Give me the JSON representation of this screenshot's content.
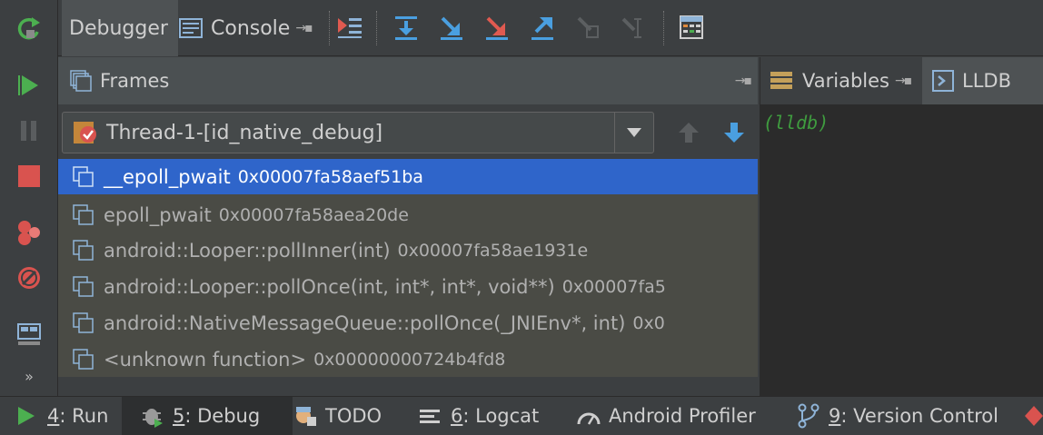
{
  "tabs": {
    "debugger": "Debugger",
    "console": "Console"
  },
  "frames_panel": {
    "title": "Frames",
    "thread": "Thread-1-[id_native_debug]",
    "frames": [
      {
        "fn": "__epoll_pwait",
        "addr": "0x00007fa58aef51ba",
        "selected": true
      },
      {
        "fn": "epoll_pwait",
        "addr": "0x00007fa58aea20de",
        "selected": false
      },
      {
        "fn": "android::Looper::pollInner(int)",
        "addr": "0x00007fa58ae1931e",
        "selected": false
      },
      {
        "fn": "android::Looper::pollOnce(int, int*, int*, void**)",
        "addr": "0x00007fa5",
        "selected": false
      },
      {
        "fn": "android::NativeMessageQueue::pollOnce(_JNIEnv*, int)",
        "addr": "0x0",
        "selected": false
      },
      {
        "fn": "<unknown function>",
        "addr": "0x00000000724b4fd8",
        "selected": false
      }
    ]
  },
  "right_panel": {
    "variables_tab": "Variables",
    "lldb_tab": "LLDB",
    "prompt": "(lldb)"
  },
  "bottom_bar": {
    "run": {
      "num": "4",
      "label": ": Run"
    },
    "debug": {
      "num": "5",
      "label": ": Debug"
    },
    "todo": {
      "label": "TODO"
    },
    "logcat": {
      "num": "6",
      "label": ": Logcat"
    },
    "profiler": {
      "label": "Android Profiler"
    },
    "vcs": {
      "num": "9",
      "label": ": Version Control"
    }
  },
  "colors": {
    "accent_selection": "#2f65ca",
    "run_green": "#4caf50",
    "stop_red": "#d9534f",
    "lldb_prompt": "#3f9c3f"
  },
  "icons": [
    "rerun-icon",
    "resume-icon",
    "pause-icon",
    "stop-icon",
    "view-breakpoints-icon",
    "mute-breakpoints-icon",
    "layout-icon",
    "more-icon",
    "step-over-icon",
    "step-into-icon",
    "force-step-into-icon",
    "step-out-icon",
    "drop-frame-icon",
    "run-to-cursor-icon",
    "evaluate-icon"
  ]
}
